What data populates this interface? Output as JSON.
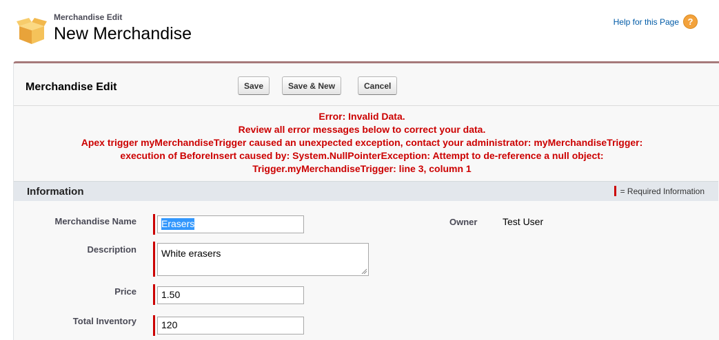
{
  "header": {
    "subtitle": "Merchandise Edit",
    "title": "New Merchandise",
    "help_label": "Help for this Page",
    "help_icon": "question-mark-icon",
    "object_icon": "box-icon"
  },
  "panel": {
    "title": "Merchandise Edit",
    "buttons": {
      "save": "Save",
      "save_new": "Save & New",
      "cancel": "Cancel"
    },
    "errors": [
      "Error: Invalid Data.",
      "Review all error messages below to correct your data.",
      "Apex trigger myMerchandiseTrigger caused an unexpected exception, contact your administrator: myMerchandiseTrigger:",
      "execution of BeforeInsert caused by: System.NullPointerException: Attempt to de-reference a null object:",
      "Trigger.myMerchandiseTrigger: line 3, column 1"
    ],
    "section": {
      "title": "Information",
      "required_legend": "= Required Information"
    },
    "fields": {
      "name": {
        "label": "Merchandise Name",
        "value": "Erasers"
      },
      "description": {
        "label": "Description",
        "value": "White erasers"
      },
      "price": {
        "label": "Price",
        "value": "1.50"
      },
      "inventory": {
        "label": "Total Inventory",
        "value": "120"
      },
      "owner": {
        "label": "Owner",
        "value": "Test User"
      }
    }
  },
  "colors": {
    "error": "#cc0000",
    "required": "#cc0000",
    "panel_border": "#a6797a",
    "link": "#015ba7"
  }
}
